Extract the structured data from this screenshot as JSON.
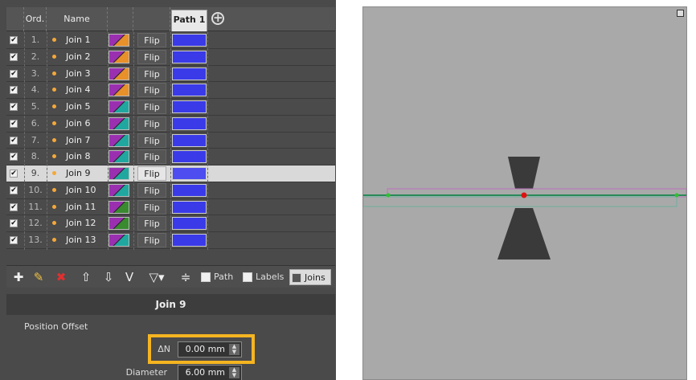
{
  "table": {
    "columns": {
      "order": "Ord.",
      "name": "Name"
    },
    "path_tab": "Path 1",
    "add_path": "+",
    "flip_label": "Flip",
    "rows": [
      {
        "order": "1.",
        "name": "Join 1",
        "icon": "orange"
      },
      {
        "order": "2.",
        "name": "Join 2",
        "icon": "orange"
      },
      {
        "order": "3.",
        "name": "Join 3",
        "icon": "orange"
      },
      {
        "order": "4.",
        "name": "Join 4",
        "icon": "orange"
      },
      {
        "order": "5.",
        "name": "Join 5",
        "icon": "teal"
      },
      {
        "order": "6.",
        "name": "Join 6",
        "icon": "teal"
      },
      {
        "order": "7.",
        "name": "Join 7",
        "icon": "teal"
      },
      {
        "order": "8.",
        "name": "Join 8",
        "icon": "teal"
      },
      {
        "order": "9.",
        "name": "Join 9",
        "icon": "teal",
        "selected": true
      },
      {
        "order": "10.",
        "name": "Join 10",
        "icon": "teal"
      },
      {
        "order": "11.",
        "name": "Join 11",
        "icon": "green"
      },
      {
        "order": "12.",
        "name": "Join 12",
        "icon": "green"
      },
      {
        "order": "13.",
        "name": "Join 13",
        "icon": "teal"
      }
    ]
  },
  "toolbar": {
    "path_label": "Path",
    "labels_label": "Labels",
    "joins_label": "Joins"
  },
  "properties": {
    "title": "Join 9",
    "position_offset_label": "Position Offset",
    "delta_n_label": "ΔN",
    "delta_n_value": "0.00 mm",
    "diameter_label": "Diameter",
    "diameter_value": "6.00 mm"
  },
  "colors": {
    "path_color": "#3a3ae8",
    "highlight": "#f5b520",
    "join_dot": "#f4a83a",
    "center_point": "#e01010",
    "path_line": "#2a8a5a"
  }
}
